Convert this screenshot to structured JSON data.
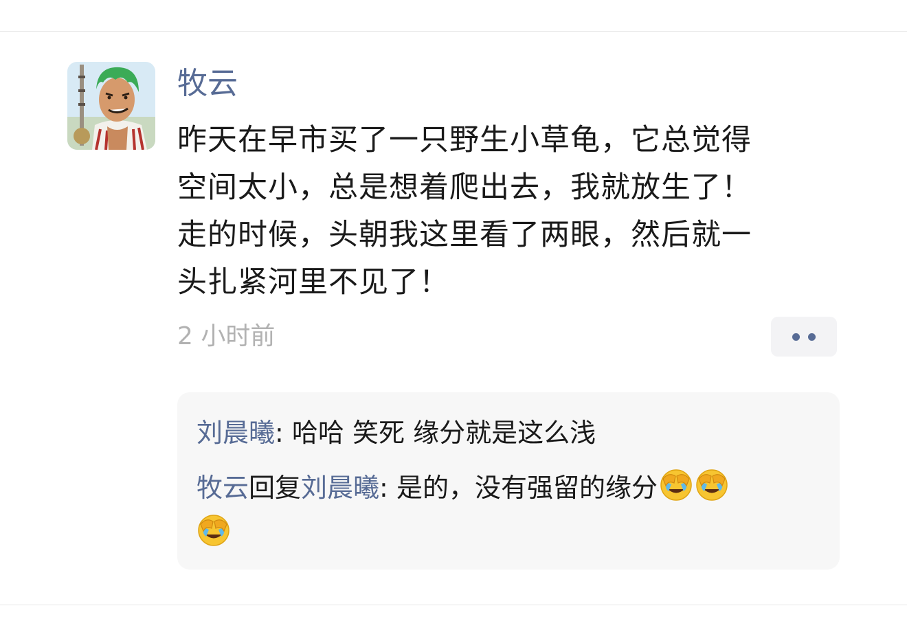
{
  "post": {
    "author": "牧云",
    "text_lines": [
      "昨天在早市买了一只野生小草龟，它总觉得",
      "空间太小，总是想着爬出去，我就放生了！",
      "走的时候，头朝我这里看了两眼，然后就一",
      "头扎紧河里不见了！"
    ],
    "time": "2 小时前",
    "more_icon": "more-dots-icon"
  },
  "comments": [
    {
      "author": "刘晨曦",
      "separator": ": ",
      "text": "哈哈 笑死 缘分就是这么浅"
    },
    {
      "author": "牧云",
      "reply_word": "回复",
      "reply_to": "刘晨曦",
      "separator": ": ",
      "text": "是的，没有强留的缘分",
      "emojis": [
        "facepalm-laugh-emoji",
        "facepalm-laugh-emoji",
        "facepalm-laugh-emoji"
      ]
    }
  ],
  "colors": {
    "name": "#576b95",
    "text": "#1a1a1a",
    "time": "#b2b2b2",
    "comment_bg": "#f7f7f7"
  }
}
